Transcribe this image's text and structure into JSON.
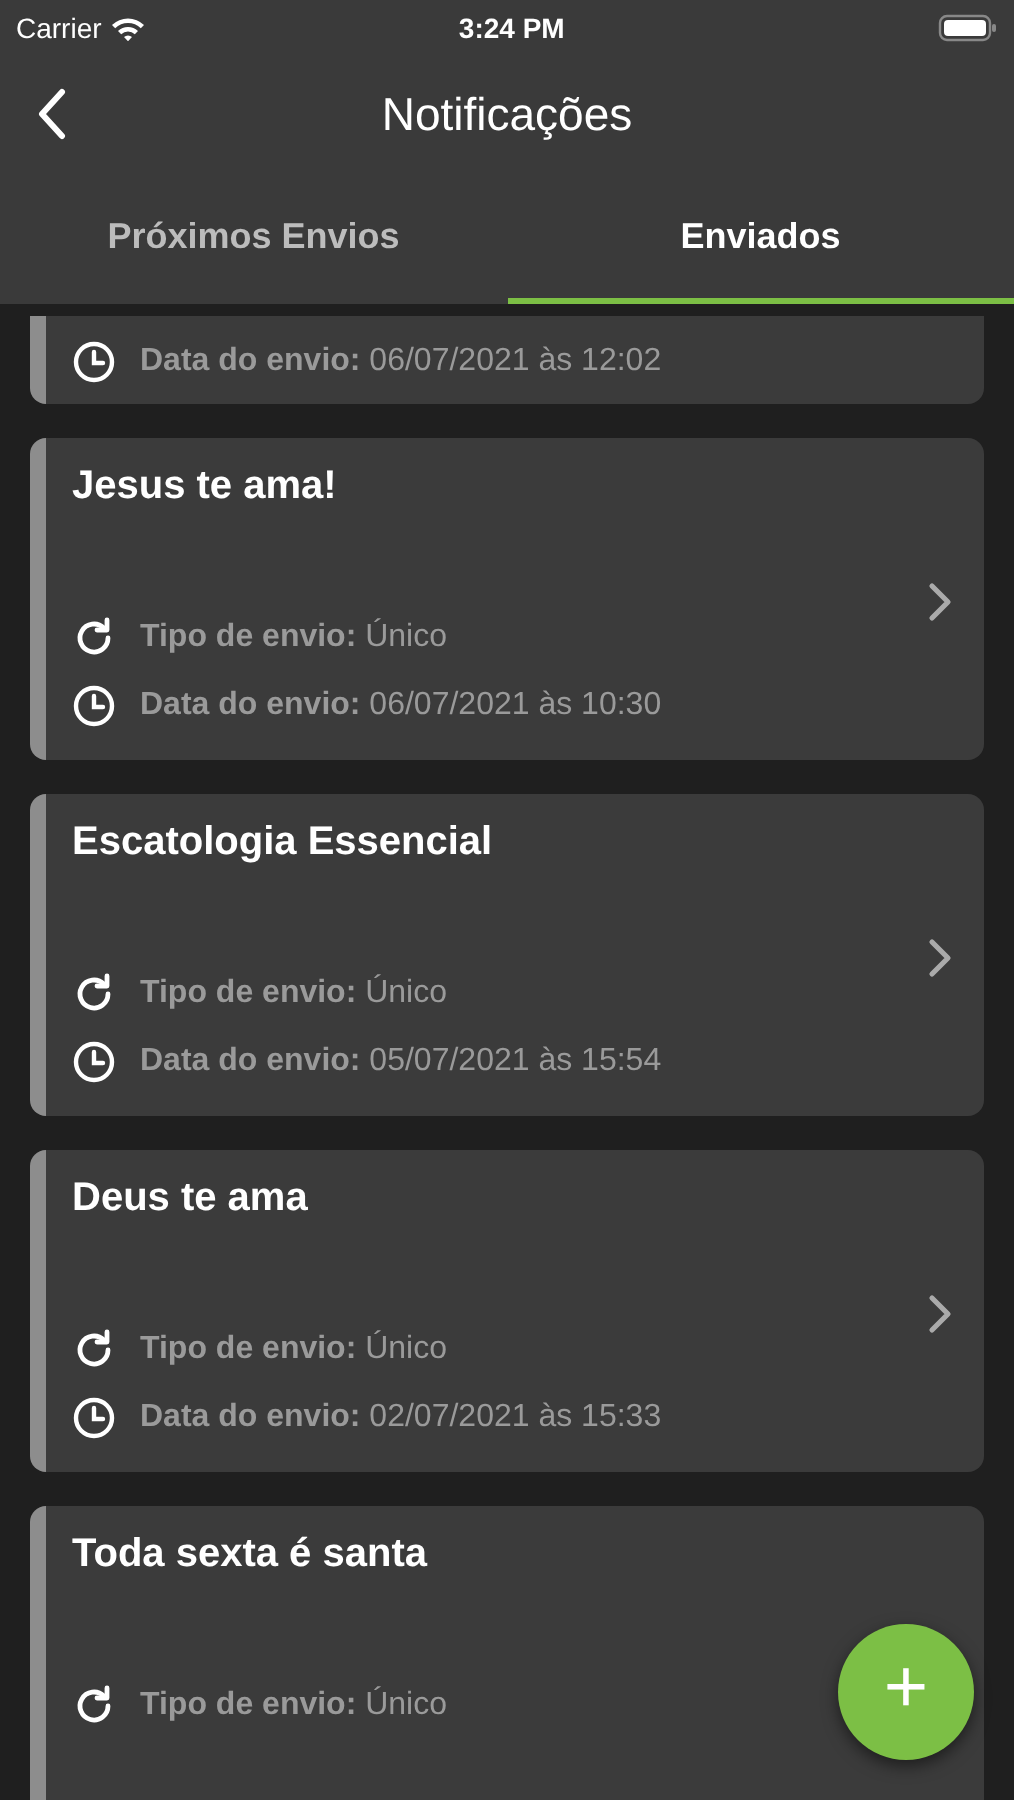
{
  "status_bar": {
    "carrier": "Carrier",
    "time": "3:24 PM"
  },
  "header": {
    "title": "Notificações"
  },
  "tabs": [
    {
      "label": "Próximos Envios",
      "selected": false
    },
    {
      "label": "Enviados",
      "selected": true
    }
  ],
  "notifications": [
    {
      "kind": "top-cut",
      "date": {
        "label": "Data do envio:",
        "value": "06/07/2021 às 12:02"
      }
    },
    {
      "kind": "full",
      "title": "Jesus te ama!",
      "type": {
        "label": "Tipo de envio:",
        "value": "Único"
      },
      "date": {
        "label": "Data do envio:",
        "value": "06/07/2021 às 10:30"
      }
    },
    {
      "kind": "full",
      "title": "Escatologia Essencial",
      "type": {
        "label": "Tipo de envio:",
        "value": "Único"
      },
      "date": {
        "label": "Data do envio:",
        "value": "05/07/2021 às 15:54"
      }
    },
    {
      "kind": "full",
      "title": "Deus te ama",
      "type": {
        "label": "Tipo de envio:",
        "value": "Único"
      },
      "date": {
        "label": "Data do envio:",
        "value": "02/07/2021 às 15:33"
      }
    },
    {
      "kind": "bottom-cut",
      "title": "Toda sexta é santa",
      "type": {
        "label": "Tipo de envio:",
        "value": "Único"
      }
    }
  ],
  "fab": {
    "label": "+"
  }
}
